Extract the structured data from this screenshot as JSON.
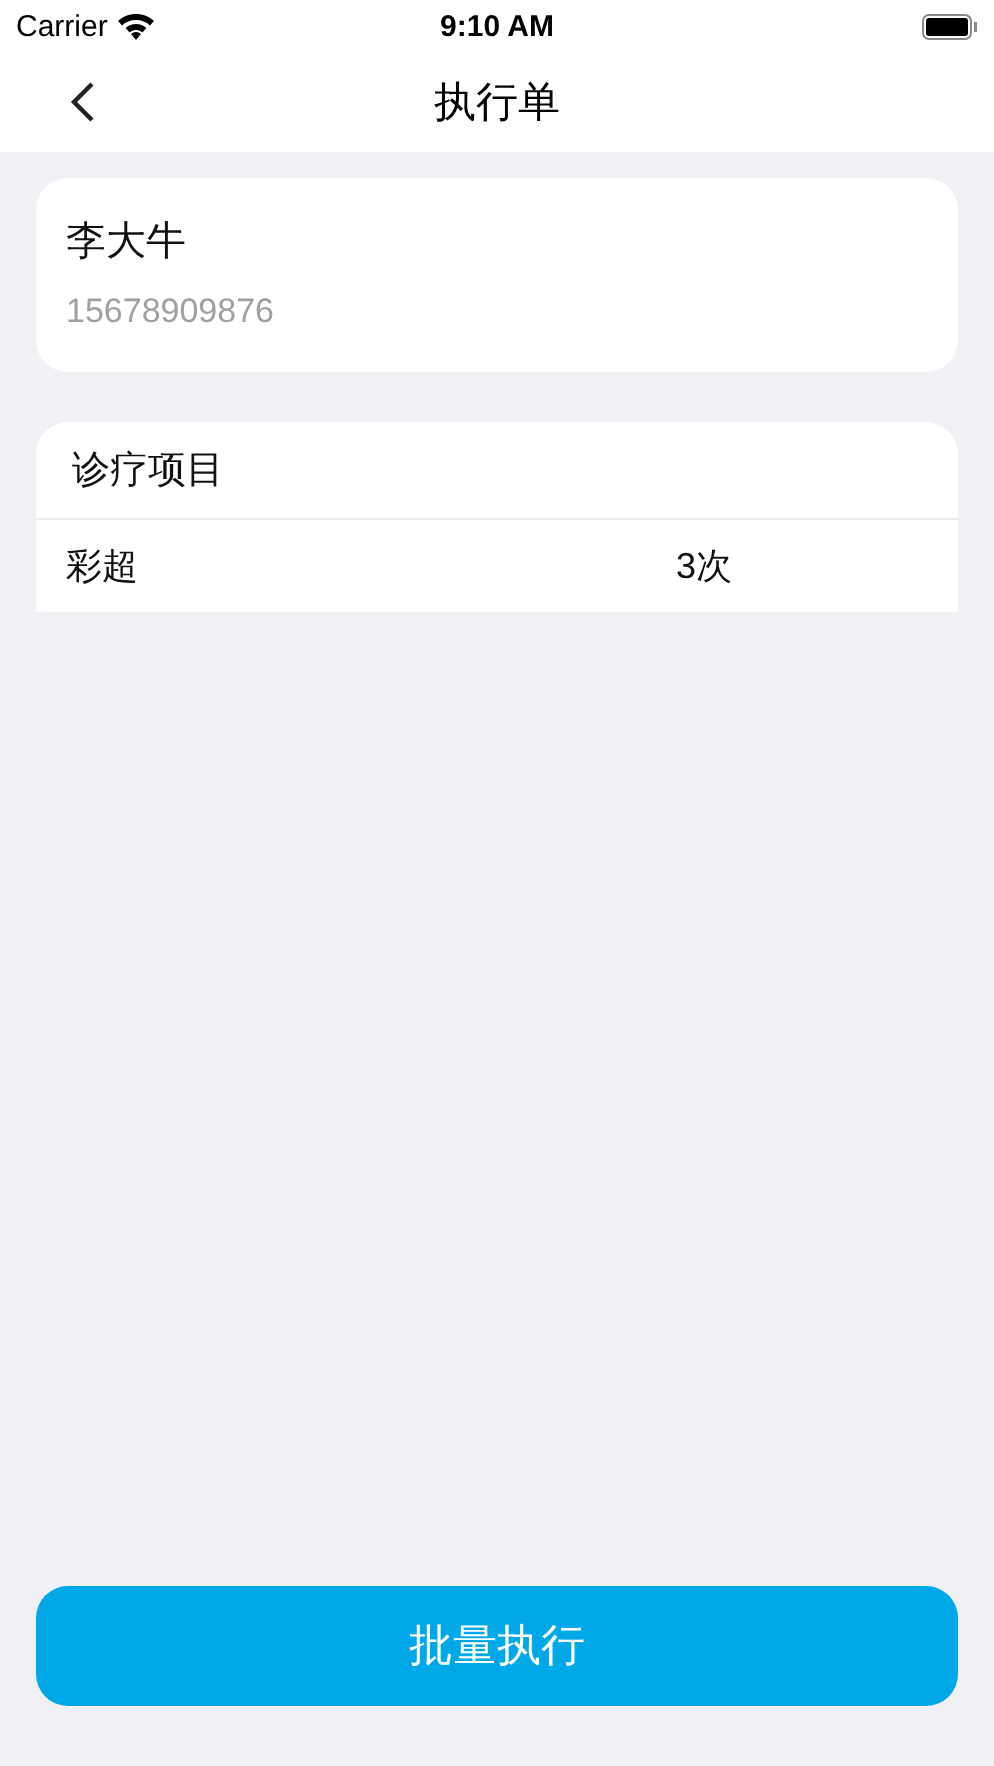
{
  "status_bar": {
    "carrier": "Carrier",
    "time": "9:10 AM"
  },
  "nav": {
    "title": "执行单"
  },
  "patient": {
    "name": "李大牛",
    "phone": "15678909876"
  },
  "items": {
    "title": "诊疗项目",
    "rows": [
      {
        "name": "彩超",
        "count": "3次"
      }
    ]
  },
  "action": {
    "label": "批量执行"
  }
}
